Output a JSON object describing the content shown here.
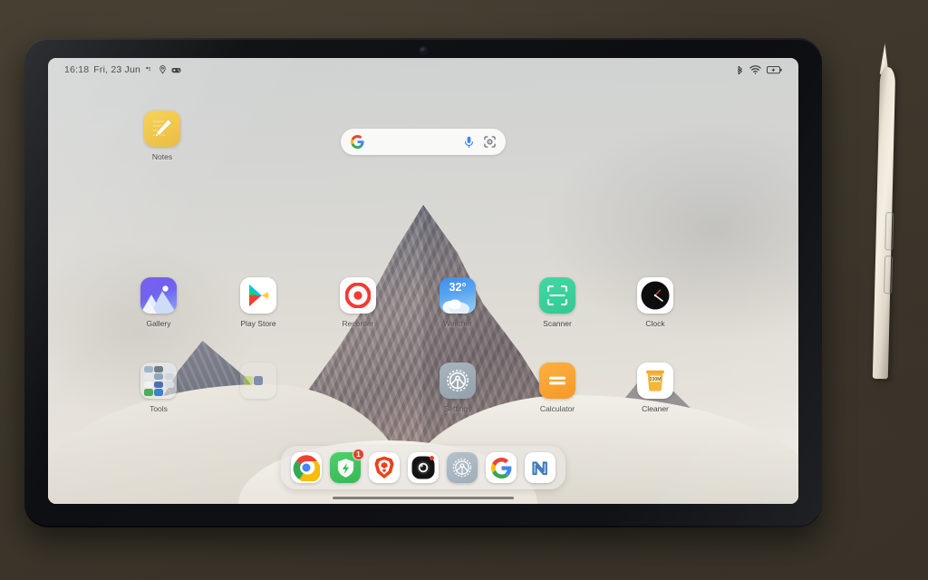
{
  "device": {
    "type": "android-tablet",
    "accessory": "stylus-pen",
    "bezel_color": "#111318",
    "desk_color": "#3f392d"
  },
  "status_bar": {
    "time": "16:18",
    "date": "Fri, 23 Jun",
    "left_icons": [
      "dnd-icon",
      "location-icon",
      "game-turbo-icon"
    ],
    "right_icons": [
      "bluetooth-icon",
      "wifi-icon",
      "battery-icon"
    ]
  },
  "search": {
    "logo": "google-g-icon",
    "placeholder": "",
    "value": "",
    "mic_icon": "microphone-icon",
    "lens_icon": "google-lens-icon"
  },
  "home_screen": {
    "rows": [
      {
        "apps": [
          {
            "label": "Notes",
            "icon": "notes-icon",
            "color": "#f0c23f"
          }
        ]
      },
      {
        "apps": [
          {
            "label": "Gallery",
            "icon": "gallery-icon",
            "color": "#7259ef"
          },
          {
            "label": "Play Store",
            "icon": "play-store-icon",
            "color": "#ffffff"
          },
          {
            "label": "Recorder",
            "icon": "screen-recorder-icon",
            "color": "#f23b33"
          },
          {
            "label": "Weather",
            "icon": "weather-icon",
            "color": "#4a95ea",
            "temperature": "32°"
          },
          {
            "label": "Scanner",
            "icon": "scanner-icon",
            "color": "#38cf99"
          },
          {
            "label": "Clock",
            "icon": "clock-icon",
            "color": "#111111"
          }
        ]
      },
      {
        "apps": [
          {
            "label": "Tools",
            "icon": "folder-icon",
            "color": "#eeeeec"
          },
          {
            "label": "",
            "icon": "folder-icon",
            "color": "#eeeeec"
          },
          {
            "label": "Settings",
            "icon": "settings-icon",
            "color": "#9aa7b1"
          },
          {
            "label": "Calculator",
            "icon": "calculator-icon",
            "color": "#f79e2c"
          },
          {
            "label": "Cleaner",
            "icon": "cleaner-icon",
            "color": "#f5b638",
            "storage": "230M"
          }
        ]
      }
    ]
  },
  "dock": {
    "apps": [
      {
        "label": "Chrome",
        "icon": "chrome-icon",
        "badge": ""
      },
      {
        "label": "Security",
        "icon": "security-icon",
        "badge": "1"
      },
      {
        "label": "Brave",
        "icon": "brave-icon",
        "badge": ""
      },
      {
        "label": "Camera",
        "icon": "camera-icon",
        "badge": ""
      },
      {
        "label": "Settings",
        "icon": "settings-icon",
        "badge": ""
      },
      {
        "label": "Google",
        "icon": "google-icon",
        "badge": ""
      },
      {
        "label": "Notion",
        "icon": "notion-icon",
        "badge": ""
      }
    ]
  },
  "navigation": {
    "type": "gesture-bar"
  }
}
